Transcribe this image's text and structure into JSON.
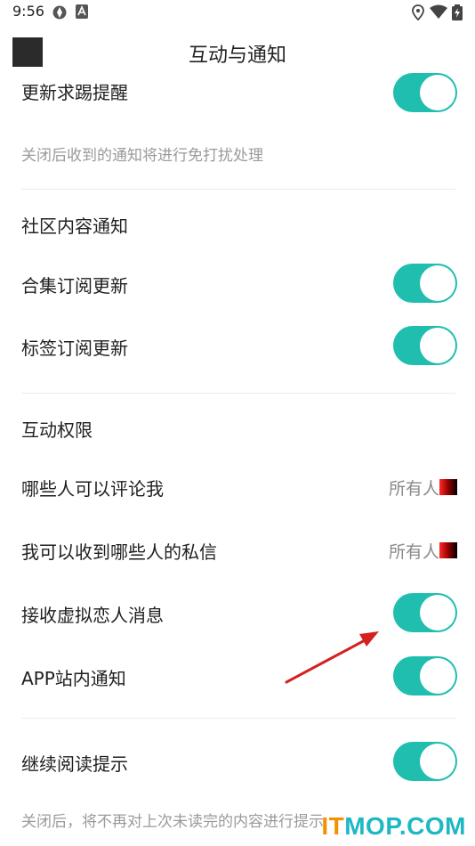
{
  "status_bar": {
    "time": "9:56"
  },
  "header": {
    "title": "互动与通知"
  },
  "items": {
    "update_reminder": {
      "label": "更新求踢提醒",
      "enabled": true
    },
    "dnd_hint": "关闭后收到的通知将进行免打扰处理",
    "community_section": "社区内容通知",
    "collection_updates": {
      "label": "合集订阅更新",
      "enabled": true
    },
    "tag_updates": {
      "label": "标签订阅更新",
      "enabled": true
    },
    "interaction_section": "互动权限",
    "who_can_comment": {
      "label": "哪些人可以评论我",
      "value": "所有人"
    },
    "who_can_message": {
      "label": "我可以收到哪些人的私信",
      "value": "所有人"
    },
    "virtual_lover": {
      "label": "接收虚拟恋人消息",
      "enabled": true
    },
    "app_notifications": {
      "label": "APP站内通知",
      "enabled": true
    },
    "continue_reading": {
      "label": "继续阅读提示",
      "enabled": true
    },
    "continue_hint": "关闭后，将不再对上次未读完的内容进行提示"
  },
  "watermark": {
    "part1": "IT",
    "part2": "MOP.COM"
  },
  "colors": {
    "toggle_on": "#1fbeaf",
    "arrow": "#d42020"
  }
}
